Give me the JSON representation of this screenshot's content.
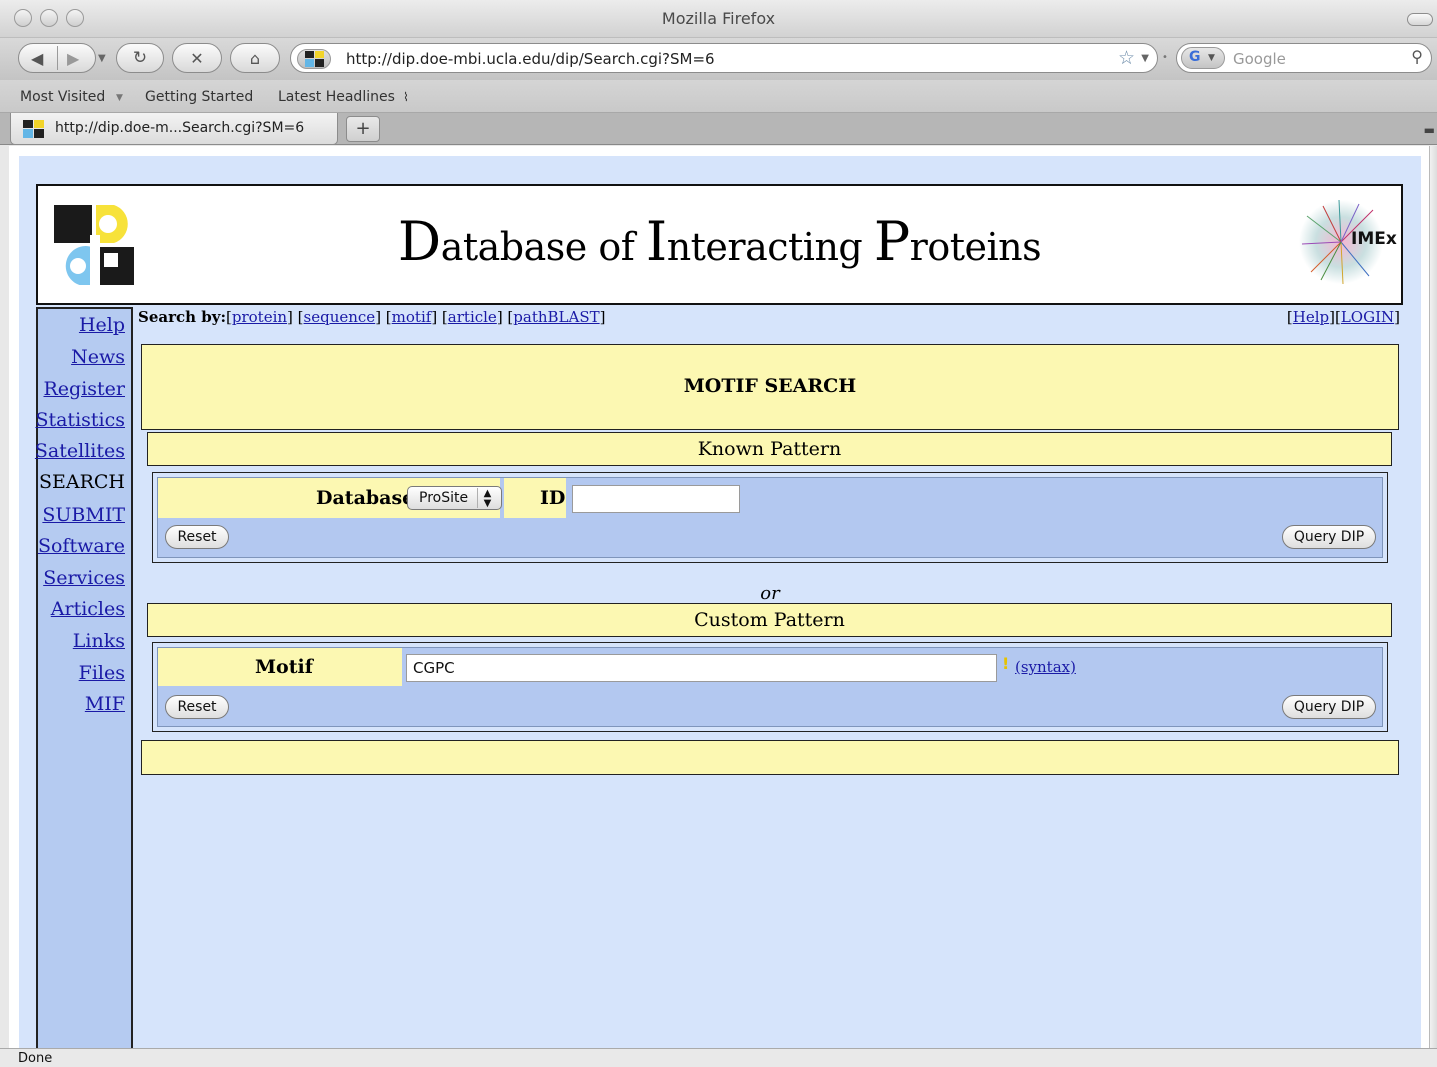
{
  "window": {
    "title": "Mozilla Firefox"
  },
  "toolbar": {
    "back_icon": "back-arrow-icon",
    "forward_icon": "forward-arrow-icon",
    "reload_icon": "reload-icon",
    "stop_icon": "stop-icon",
    "home_icon": "home-icon",
    "url": "http://dip.doe-mbi.ucla.edu/dip/Search.cgi?SM=6",
    "search_placeholder": "Google"
  },
  "bookmarks": [
    "Most Visited",
    "Getting Started",
    "Latest Headlines"
  ],
  "tab": {
    "label": "http://dip.doe-m...Search.cgi?SM=6",
    "new_tab": "+"
  },
  "header": {
    "title_d": "D",
    "title_atabase": "atabase of ",
    "title_i": "I",
    "title_nteracting": "nteracting ",
    "title_p": "P",
    "title_roteins": "roteins",
    "imex_label": "IMEx"
  },
  "sidenav": [
    {
      "label": "Help",
      "current": false
    },
    {
      "label": "News",
      "current": false
    },
    {
      "label": "Register",
      "current": false
    },
    {
      "label": "Statistics",
      "current": false
    },
    {
      "label": "Satellites",
      "current": false
    },
    {
      "label": "SEARCH",
      "current": true
    },
    {
      "label": "SUBMIT",
      "current": false
    },
    {
      "label": "Software",
      "current": false
    },
    {
      "label": "Services",
      "current": false
    },
    {
      "label": "Articles",
      "current": false
    },
    {
      "label": "Links",
      "current": false
    },
    {
      "label": "Files",
      "current": false
    },
    {
      "label": "MIF",
      "current": false
    }
  ],
  "searchby": {
    "prefix": "Search by:",
    "links": [
      "protein",
      "sequence",
      "motif",
      "article",
      "pathBLAST"
    ]
  },
  "toplinks": {
    "help": "Help",
    "login": "LOGIN"
  },
  "main": {
    "heading": "MOTIF SEARCH",
    "known": {
      "title": "Known Pattern",
      "database_label": "Database",
      "database_value": "ProSite",
      "id_label": "ID",
      "id_value": "",
      "reset": "Reset",
      "submit": "Query DIP"
    },
    "or": "or",
    "custom": {
      "title": "Custom Pattern",
      "motif_label": "Motif",
      "motif_value": "CGPC",
      "syntax_link": "(syntax)",
      "reset": "Reset",
      "submit": "Query DIP"
    }
  },
  "status": "Done",
  "colors": {
    "page_bg": "#d6e4fb",
    "nav_bg": "#b5cbf1",
    "yellow": "#fcf8b2",
    "link": "#1a1aa6"
  }
}
